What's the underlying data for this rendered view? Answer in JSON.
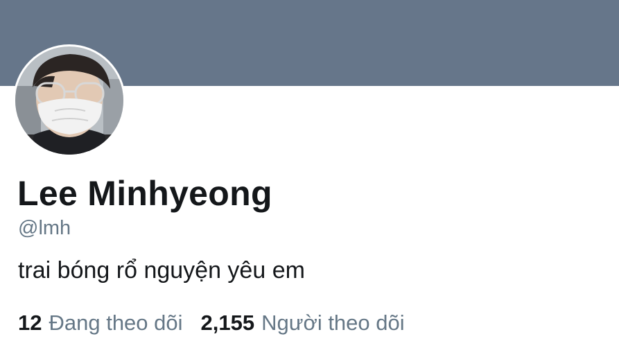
{
  "profile": {
    "display_name": "Lee Minhyeong",
    "handle": "@lmh",
    "bio": "trai bóng rổ nguyện yêu em"
  },
  "stats": {
    "following_count": "12",
    "following_label": "Đang theo dõi",
    "followers_count": "2,155",
    "followers_label": "Người theo dõi"
  },
  "colors": {
    "banner": "#66768a",
    "primary_text": "#14171a",
    "secondary_text": "#657786"
  }
}
